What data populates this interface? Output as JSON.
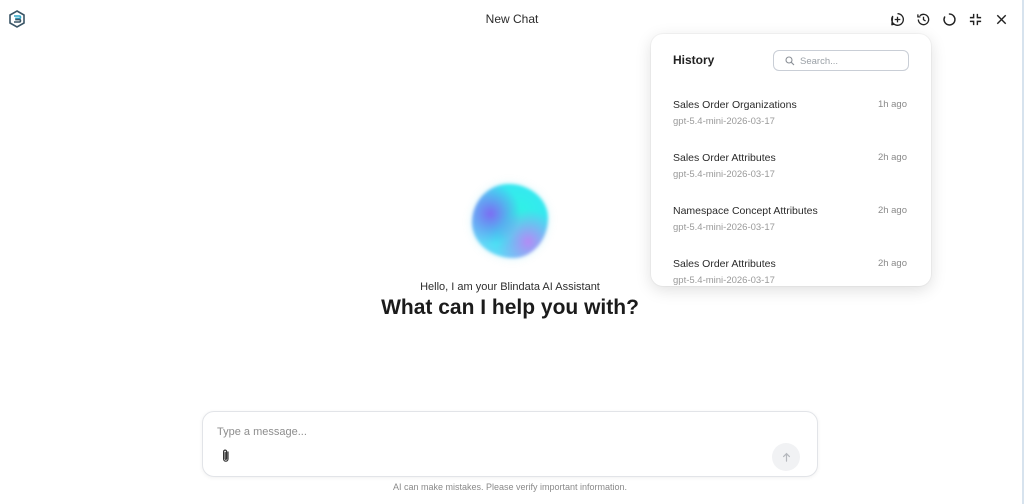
{
  "header": {
    "title": "New Chat",
    "icons": [
      "new-chat-icon",
      "history-icon",
      "spinner-icon",
      "collapse-icon",
      "close-icon"
    ]
  },
  "hero": {
    "greeting": "Hello, I am your Blindata AI Assistant",
    "headline": "What can I help you with?"
  },
  "history": {
    "title": "History",
    "search_placeholder": "Search...",
    "items": [
      {
        "title": "Sales Order Organizations",
        "time": "1h ago",
        "model": "gpt-5.4-mini-2026-03-17"
      },
      {
        "title": "Sales Order Attributes",
        "time": "2h ago",
        "model": "gpt-5.4-mini-2026-03-17"
      },
      {
        "title": "Namespace Concept Attributes",
        "time": "2h ago",
        "model": "gpt-5.4-mini-2026-03-17"
      },
      {
        "title": "Sales Order Attributes",
        "time": "2h ago",
        "model": "gpt-5.4-mini-2026-03-17"
      }
    ]
  },
  "composer": {
    "placeholder": "Type a message...",
    "disclaimer": "AI can make mistakes. Please verify important information."
  },
  "colors": {
    "accent": "#2fa7c9",
    "orb_primary": "#2ff2e4",
    "orb_secondary": "#7d6cf2"
  }
}
